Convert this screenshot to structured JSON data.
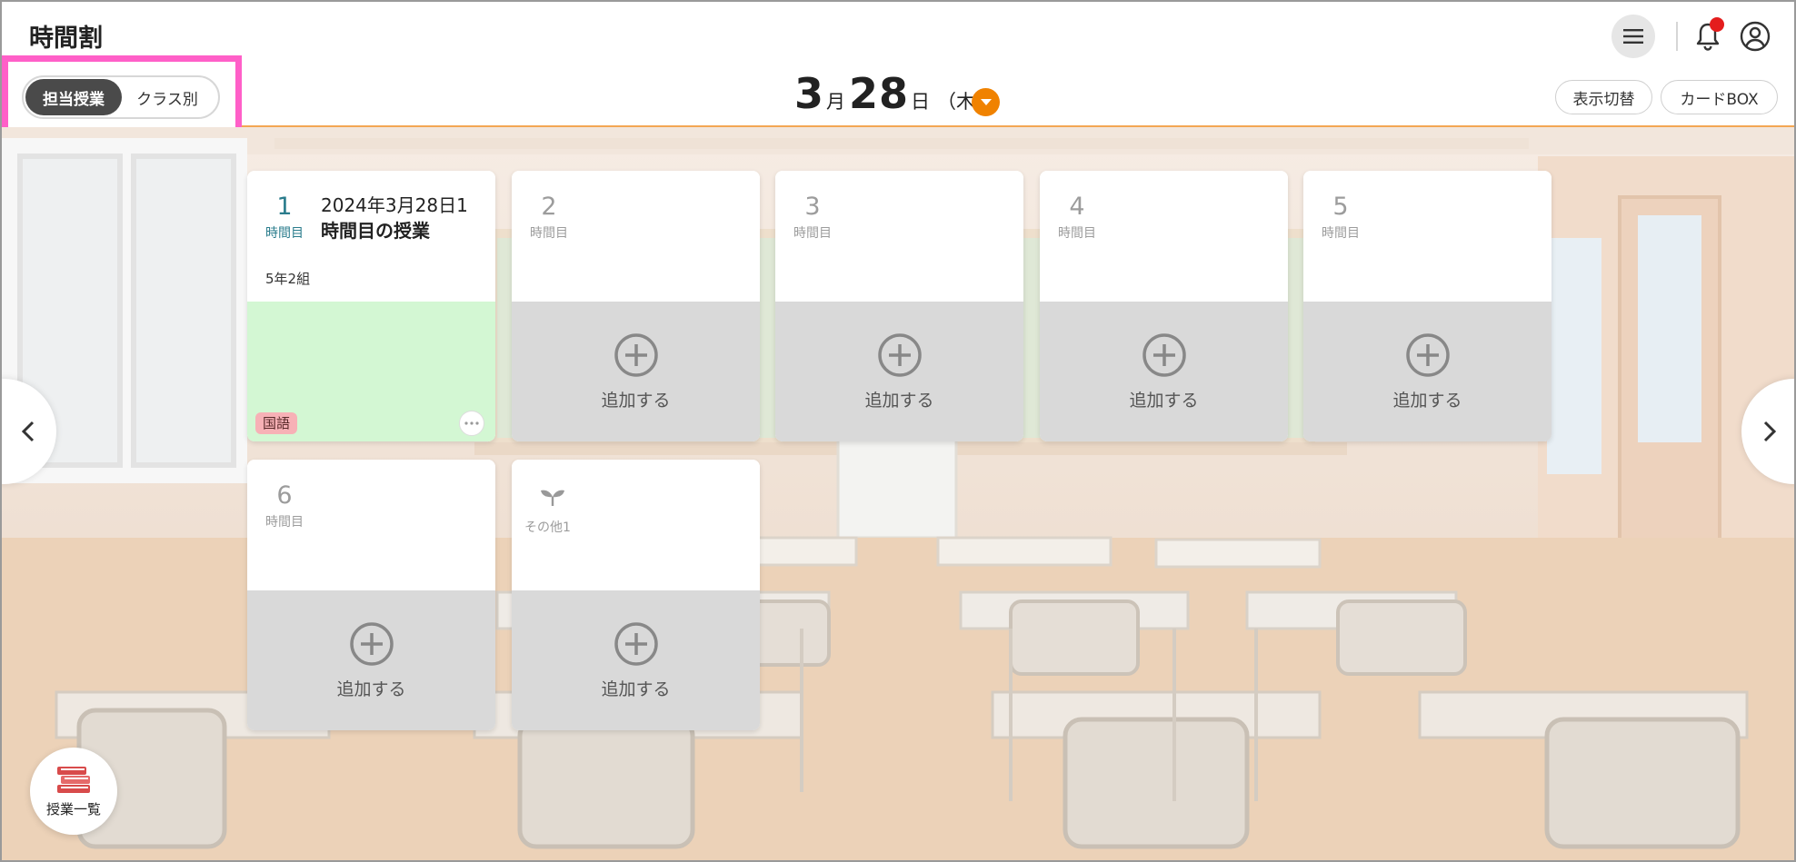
{
  "header": {
    "title": "時間割",
    "icons": [
      "menu-icon",
      "bell-icon",
      "user-icon"
    ],
    "notification_dot": true
  },
  "view_toggle": {
    "options": [
      "担当授業",
      "クラス別"
    ],
    "selected": "担当授業"
  },
  "date": {
    "month": "3",
    "month_suffix": "月",
    "day": "28",
    "day_suffix": "日",
    "weekday": "（木）"
  },
  "buttons": {
    "toggle_view": "表示切替",
    "card_box": "カードBOX"
  },
  "periods": [
    {
      "number": "1",
      "label": "時間目",
      "lesson_title_line1": "2024年3月28日1",
      "lesson_title_line2": "時間目の授業",
      "class_name": "5年2組",
      "subject": "国語"
    },
    {
      "number": "2",
      "label": "時間目",
      "add_label": "追加する"
    },
    {
      "number": "3",
      "label": "時間目",
      "add_label": "追加する"
    },
    {
      "number": "4",
      "label": "時間目",
      "add_label": "追加する"
    },
    {
      "number": "5",
      "label": "時間目",
      "add_label": "追加する"
    },
    {
      "number": "6",
      "label": "時間目",
      "add_label": "追加する"
    },
    {
      "label": "その他1",
      "icon": "sprout-icon",
      "add_label": "追加する"
    }
  ],
  "fab": {
    "label": "授業一覧",
    "icon": "books-icon"
  },
  "colors": {
    "accent_orange": "#f08200",
    "highlight_pink": "#ff5fc8",
    "period_teal": "#2a7c8c",
    "lesson_green": "#d3f7d3",
    "subject_tag": "#f7b1b6"
  }
}
